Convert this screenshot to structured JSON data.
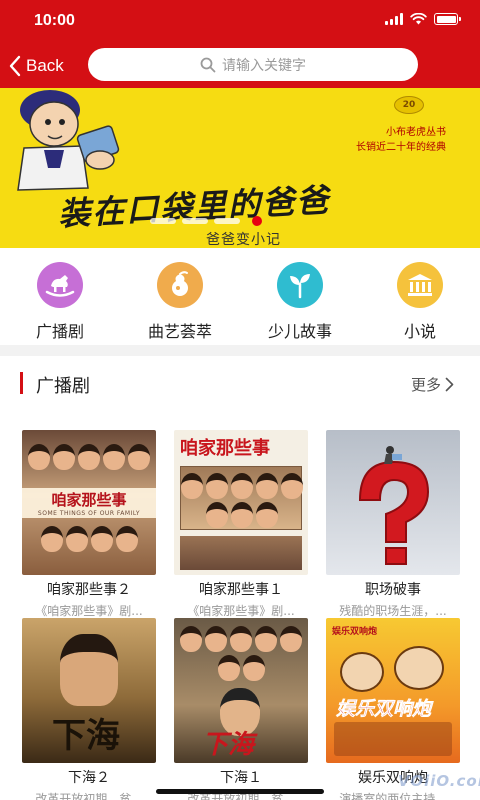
{
  "status_bar": {
    "time": "10:00"
  },
  "nav": {
    "back_label": "Back",
    "search_placeholder": "请输入关键字"
  },
  "banner": {
    "title": "装在口袋里的爸爸",
    "subtitle": "爸爸变小记",
    "series_line1": "小布老虎丛书",
    "series_line2": "长销近二十年的经典",
    "badge": "20",
    "slide_count": 4,
    "active_slide": 4
  },
  "categories": [
    {
      "label": "广播剧",
      "icon": "rocking-horse-icon",
      "color": "#c66fd6"
    },
    {
      "label": "曲艺荟萃",
      "icon": "gourd-icon",
      "color": "#f0ab4c"
    },
    {
      "label": "少儿故事",
      "icon": "sprout-icon",
      "color": "#2fbcd0"
    },
    {
      "label": "小说",
      "icon": "library-icon",
      "color": "#f5c23c"
    }
  ],
  "section": {
    "title": "广播剧",
    "more_label": "更多"
  },
  "items": [
    {
      "title": "咱家那些事２",
      "desc": "《咱家那些事》剧...",
      "poster_title": "咱家那些事",
      "poster_subtitle": "SOME THINGS OF OUR FAMILY"
    },
    {
      "title": "咱家那些事１",
      "desc": "《咱家那些事》剧...",
      "poster_title": "咱家那些事"
    },
    {
      "title": "职场破事",
      "desc": "残酷的职场生涯，..."
    },
    {
      "title": "下海２",
      "desc": "改革开放初期，贫...",
      "poster_title": "下海"
    },
    {
      "title": "下海１",
      "desc": "改革开放初期，贫...",
      "poster_title": "下海"
    },
    {
      "title": "娱乐双响炮",
      "desc": "演播室的两位主持...",
      "poster_title": "娱乐双响炮",
      "poster_tag": "娱乐双响炮"
    }
  ],
  "watermark": "VOiiO.com",
  "colors": {
    "brand_red": "#d40f14",
    "banner_yellow": "#f6dc12"
  }
}
